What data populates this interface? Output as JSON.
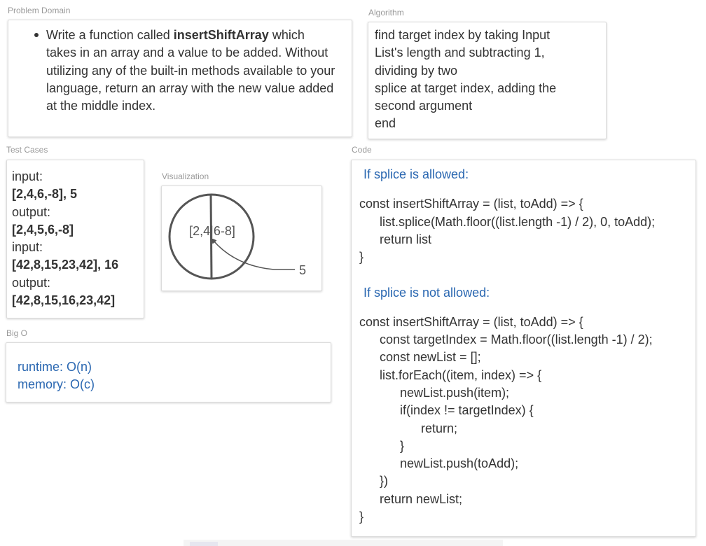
{
  "sections": {
    "problem_domain": "Problem Domain",
    "algorithm": "Algorithm",
    "test_cases": "Test Cases",
    "visualization": "Visualization",
    "code": "Code",
    "big_o": "Big O"
  },
  "problem": {
    "pre": "Write a function called ",
    "bold": "insertShiftArray",
    "post": " which takes in an array and a value to be added. Without utilizing any of the built-in methods available to your language, return an array with the new value added at the middle index."
  },
  "algorithm_lines": [
    "find target index by taking Input",
    "List's length and subtracting 1,",
    "dividing by two",
    "splice at target index, adding the",
    "second argument",
    "end"
  ],
  "test_cases": [
    {
      "text": "input:",
      "bold": false
    },
    {
      "text": "[2,4,6,-8], 5",
      "bold": true
    },
    {
      "text": "output:",
      "bold": false
    },
    {
      "text": "[2,4,5,6,-8]",
      "bold": true
    },
    {
      "text": "input:",
      "bold": false
    },
    {
      "text": "[42,8,15,23,42], 16",
      "bold": true
    },
    {
      "text": "output:",
      "bold": false
    },
    {
      "text": "[42,8,15,16,23,42]",
      "bold": true
    }
  ],
  "visualization": {
    "array_label": "[2,4|6-8]",
    "value_label": "5"
  },
  "code": {
    "splice_heading": "If splice is allowed:",
    "splice_lines": [
      {
        "text": "const insertShiftArray = (list, toAdd) => {",
        "indent": 0
      },
      {
        "text": "list.splice(Math.floor((list.length -1) / 2), 0, toAdd);",
        "indent": 1
      },
      {
        "text": "return list",
        "indent": 1
      },
      {
        "text": "}",
        "indent": 0
      }
    ],
    "nosplice_heading": "If splice is not allowed:",
    "nosplice_lines": [
      {
        "text": "const insertShiftArray = (list, toAdd) => {",
        "indent": 0
      },
      {
        "text": "const targetIndex = Math.floor((list.length -1) / 2);",
        "indent": 1
      },
      {
        "text": "const newList = [];",
        "indent": 1
      },
      {
        "text": "list.forEach((item, index) => {",
        "indent": 1
      },
      {
        "text": "newList.push(item);",
        "indent": 2
      },
      {
        "text": "if(index != targetIndex) {",
        "indent": 2
      },
      {
        "text": "return;",
        "indent": 3
      },
      {
        "text": "}",
        "indent": 2
      },
      {
        "text": "newList.push(toAdd);",
        "indent": 2
      },
      {
        "text": "})",
        "indent": 1
      },
      {
        "text": "return newList;",
        "indent": 1
      },
      {
        "text": "}",
        "indent": 0
      }
    ]
  },
  "big_o": {
    "runtime": "runtime: O(n)",
    "memory": "memory: O(c)"
  },
  "colors": {
    "accent_blue": "#2a67b1",
    "label_gray": "#9a9a9a",
    "text": "#333333"
  }
}
